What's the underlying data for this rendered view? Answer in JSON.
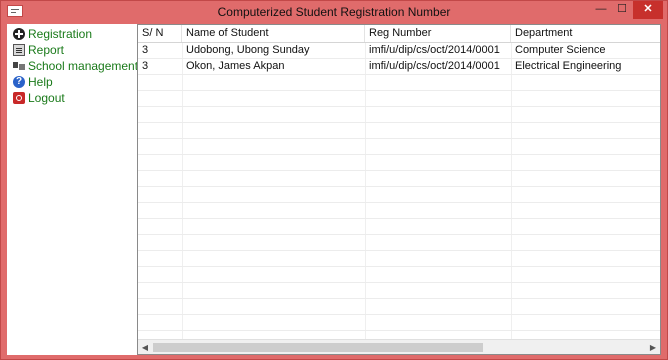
{
  "window": {
    "title": "Computerized Student Registration Number",
    "minimize_glyph": "—",
    "maximize_glyph": "☐",
    "close_glyph": "✕"
  },
  "nav": {
    "items": [
      {
        "label": "Registration",
        "icon": "plus-circle-icon"
      },
      {
        "label": "Report",
        "icon": "report-icon"
      },
      {
        "label": "School management",
        "icon": "school-icon"
      },
      {
        "label": "Help",
        "icon": "help-icon"
      },
      {
        "label": "Logout",
        "icon": "logout-icon"
      }
    ]
  },
  "table": {
    "columns": [
      "S/ N",
      "Name of Student",
      "Reg Number",
      "Department"
    ],
    "rows": [
      [
        "3",
        "Udobong, Ubong Sunday",
        "imfi/u/dip/cs/oct/2014/0001",
        "Computer Science"
      ],
      [
        "3",
        "Okon, James  Akpan",
        "imfi/u/dip/cs/oct/2014/0001",
        "Electrical Engineering"
      ]
    ]
  },
  "scrollbar": {
    "left_arrow": "◀",
    "right_arrow": "▶"
  },
  "colors": {
    "window_frame": "#e06b6b",
    "close_button": "#c7302c",
    "nav_text": "#1a7a1a"
  }
}
